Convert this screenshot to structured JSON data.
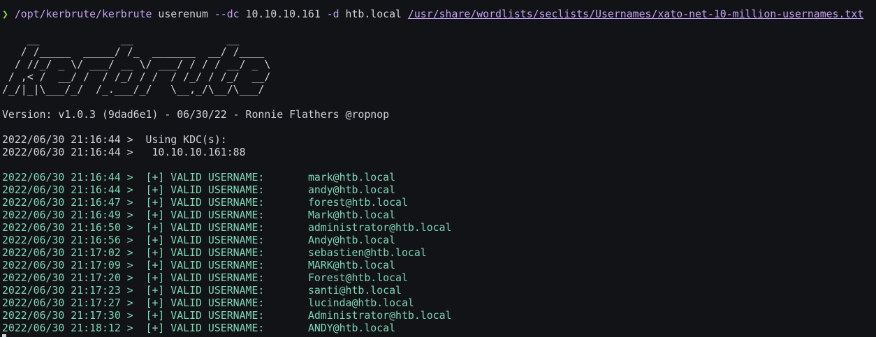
{
  "command": {
    "prompt_symbol": "❯",
    "executable": "/opt/kerbrute/kerbrute",
    "subcommand": "userenum",
    "flag_dc": "--dc",
    "dc_ip": "10.10.10.161",
    "flag_domain": "-d",
    "domain": "htb.local",
    "wordlist": "/usr/share/wordlists/seclists/Usernames/xato-net-10-million-usernames.txt"
  },
  "banner": [
    "    __             __               __     ",
    "   / /_____  _____/ /_  _______  __/ /____ ",
    "  / //_/ _ \\/ ___/ __ \\/ ___/ / / / __/ _ \\",
    " / ,< /  __/ /  / /_/ / /  / /_/ / /_/  __/",
    "/_/|_|\\___/_/  /_.___/_/   \\__,_/\\__/\\___/ "
  ],
  "version_line": "Version: v1.0.3 (9dad6e1) - 06/30/22 - Ronnie Flathers @ropnop",
  "kdc_lines": [
    "2022/06/30 21:16:44 >  Using KDC(s):",
    "2022/06/30 21:16:44 >   10.10.10.161:88"
  ],
  "valid_prefix": "[+] VALID USERNAME:",
  "results": [
    {
      "timestamp": "2022/06/30 21:16:44",
      "user": "mark@htb.local"
    },
    {
      "timestamp": "2022/06/30 21:16:44",
      "user": "andy@htb.local"
    },
    {
      "timestamp": "2022/06/30 21:16:47",
      "user": "forest@htb.local"
    },
    {
      "timestamp": "2022/06/30 21:16:49",
      "user": "Mark@htb.local"
    },
    {
      "timestamp": "2022/06/30 21:16:50",
      "user": "administrator@htb.local"
    },
    {
      "timestamp": "2022/06/30 21:16:56",
      "user": "Andy@htb.local"
    },
    {
      "timestamp": "2022/06/30 21:17:02",
      "user": "sebastien@htb.local"
    },
    {
      "timestamp": "2022/06/30 21:17:09",
      "user": "MARK@htb.local"
    },
    {
      "timestamp": "2022/06/30 21:17:20",
      "user": "Forest@htb.local"
    },
    {
      "timestamp": "2022/06/30 21:17:23",
      "user": "santi@htb.local"
    },
    {
      "timestamp": "2022/06/30 21:17:27",
      "user": "lucinda@htb.local"
    },
    {
      "timestamp": "2022/06/30 21:17:30",
      "user": "Administrator@htb.local"
    },
    {
      "timestamp": "2022/06/30 21:18:12",
      "user": "ANDY@htb.local"
    }
  ],
  "colors": {
    "background": "#111317",
    "prompt": "#8bd449",
    "command": "#c5a0f2",
    "valid_output": "#7ed7b3",
    "text": "#d0d3d8"
  }
}
